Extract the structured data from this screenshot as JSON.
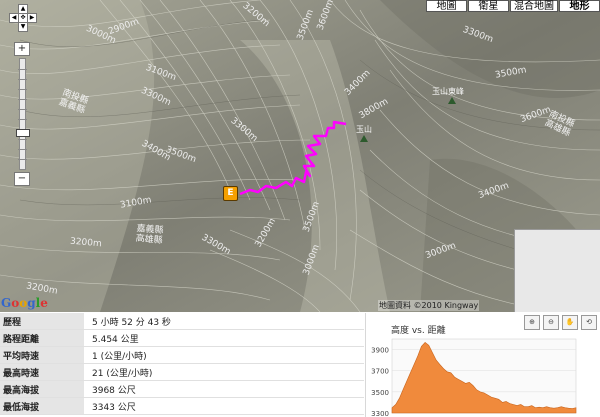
{
  "map": {
    "type_buttons": [
      "地圖",
      "衛星",
      "混合地圖",
      "地形"
    ],
    "active_type": "地形",
    "copyright": "地圖資料 ©2010 Kingway",
    "logo": "Google",
    "peaks": [
      {
        "name": "玉山東峰"
      },
      {
        "name": "玉山"
      }
    ],
    "counties": [
      {
        "top": "南投縣",
        "bottom": "嘉義縣"
      },
      {
        "top": "嘉義縣",
        "bottom": "高雄縣"
      },
      {
        "top": "南投縣",
        "bottom": "高雄縣"
      }
    ],
    "contours": [
      "2900m",
      "3100m",
      "3000m",
      "3200m",
      "3300m",
      "3400m",
      "3500m",
      "3100m",
      "3300m",
      "3500m",
      "3600m",
      "3400m",
      "3800m",
      "3300m",
      "3500m",
      "3600m",
      "3400m",
      "3000m",
      "3200m",
      "3300m",
      "3200m",
      "3000m",
      "3500m",
      "3200m"
    ],
    "start_marker": "E",
    "track_color": "#ff00ff"
  },
  "stats": {
    "rows": [
      {
        "label": "歷程",
        "value": "5 小時 52 分 43 秒"
      },
      {
        "label": "路程距離",
        "value": "5.454 公里"
      },
      {
        "label": "平均時速",
        "value": "1 (公里/小時)"
      },
      {
        "label": "最高時速",
        "value": "21 (公里/小時)"
      },
      {
        "label": "最高海拔",
        "value": "3968 公尺"
      },
      {
        "label": "最低海拔",
        "value": "3343 公尺"
      }
    ]
  },
  "chart_data": {
    "type": "area",
    "title": "高度 vs. 距離",
    "ylim": [
      3300,
      4000
    ],
    "yticks": [
      3900,
      3700,
      3500,
      3300
    ],
    "color": "#f08a3c",
    "x": [
      0,
      2,
      4,
      6,
      8,
      10,
      12,
      14,
      16,
      18,
      20,
      22,
      24,
      26,
      28,
      30,
      32,
      34,
      36,
      38,
      40,
      42,
      44,
      46,
      48,
      50,
      52,
      54,
      56,
      58,
      60,
      62,
      64,
      66,
      68,
      70,
      72,
      74,
      76,
      78,
      80,
      82,
      84,
      86,
      88,
      90,
      92,
      94,
      96,
      98,
      100
    ],
    "values": [
      3350,
      3380,
      3440,
      3520,
      3600,
      3680,
      3760,
      3840,
      3930,
      3968,
      3940,
      3870,
      3800,
      3760,
      3720,
      3690,
      3680,
      3640,
      3620,
      3600,
      3580,
      3590,
      3560,
      3520,
      3500,
      3490,
      3470,
      3450,
      3440,
      3430,
      3400,
      3410,
      3390,
      3380,
      3370,
      3380,
      3360,
      3360,
      3370,
      3350,
      3355,
      3350,
      3360,
      3350,
      3345,
      3350,
      3360,
      3350,
      3345,
      3343,
      3350
    ]
  }
}
